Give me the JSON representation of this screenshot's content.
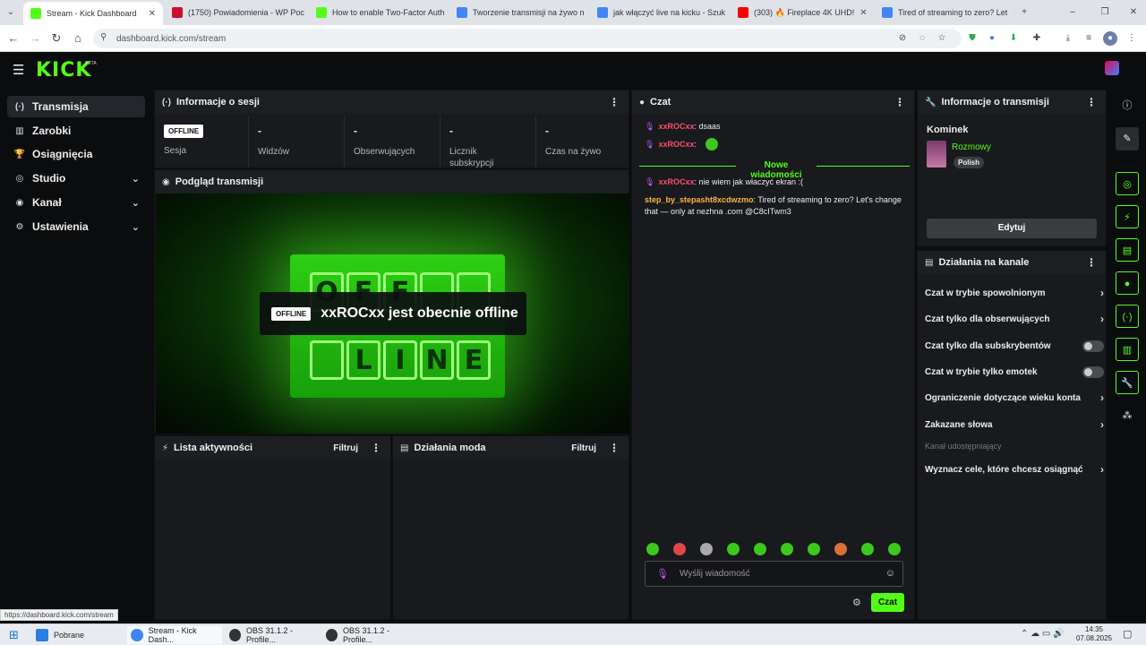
{
  "browser": {
    "tabs": [
      {
        "label": "Stream - Kick Dashboard",
        "color": "#53fc18",
        "active": true
      },
      {
        "label": "(1750) Powiadomienia - WP Poc",
        "color": "#c8102e"
      },
      {
        "label": "How to enable Two-Factor Auth",
        "color": "#53fc18"
      },
      {
        "label": "Tworzenie transmisji na żywo n",
        "color": "#4285f4"
      },
      {
        "label": "jak włączyć live na kicku - Szuk",
        "color": "#4285f4"
      },
      {
        "label": "(303) 🔥 Fireplace 4K UHD!",
        "color": "#ff0000"
      },
      {
        "label": "Tired of streaming to zero? Let",
        "color": "#4285f4"
      }
    ],
    "url": "dashboard.kick.com/stream",
    "status_url": "https://dashboard.kick.com/stream"
  },
  "kick": {
    "logo": "KICK",
    "beta": "BETA"
  },
  "sidebar": {
    "items": [
      {
        "label": "Transmisja",
        "icon": "broadcast-icon",
        "glyph": "(·)"
      },
      {
        "label": "Zarobki",
        "icon": "earnings-icon",
        "glyph": "▥"
      },
      {
        "label": "Osiągnięcia",
        "icon": "trophy-icon",
        "glyph": "🏆"
      },
      {
        "label": "Studio",
        "icon": "studio-icon",
        "glyph": "◎"
      },
      {
        "label": "Kanał",
        "icon": "channel-icon",
        "glyph": "◉"
      },
      {
        "label": "Ustawienia",
        "icon": "settings-icon",
        "glyph": "⚙"
      }
    ]
  },
  "session": {
    "title": "Informacje o sesji",
    "status_badge": "OFFLINE",
    "stats": [
      {
        "value": "",
        "label": "Sesja"
      },
      {
        "value": "-",
        "label": "Widzów"
      },
      {
        "value": "-",
        "label": "Obserwujących"
      },
      {
        "value": "-",
        "label": "Licznik subskrypcji"
      },
      {
        "value": "-",
        "label": "Czas na żywo"
      }
    ]
  },
  "preview": {
    "title": "Podgląd transmisji",
    "badge": "OFFLINE",
    "message": "xxROCxx jest obecnie offline",
    "sign_top": [
      "O",
      "F",
      "F",
      "",
      ""
    ],
    "sign_bottom": [
      "",
      "L",
      "I",
      "N",
      "E"
    ]
  },
  "activity": {
    "title": "Lista aktywności",
    "filter": "Filtruj"
  },
  "mod": {
    "title": "Działania moda",
    "filter": "Filtruj"
  },
  "chat": {
    "title": "Czat",
    "messages_before": [
      {
        "user": "xxROCxx",
        "text": "dsaas"
      },
      {
        "user": "xxROCxx",
        "text": ""
      }
    ],
    "new_messages_label": "Nowe wiadomości",
    "messages_after": [
      {
        "user": "xxROCxx",
        "text": "nie wiem jak właczyć ekran :("
      },
      {
        "user": "step_by_stepasht8xcdwzmo",
        "text": "Tired of streaming to zero? Let's change that — only at nezhna .com @C8cITwm3"
      }
    ],
    "input_placeholder": "Wyślij wiadomość",
    "send_label": "Czat"
  },
  "stream_info": {
    "title": "Informacje o transmisji",
    "stream_title": "Kominek",
    "category": "Rozmowy",
    "language": "Polish",
    "edit_label": "Edytuj"
  },
  "channel_actions": {
    "title": "Działania na kanale",
    "rows": [
      {
        "label": "Czat w trybie spowolnionym",
        "control": "chevron"
      },
      {
        "label": "Czat tylko dla obserwujących",
        "control": "chevron"
      },
      {
        "label": "Czat tylko dla subskrybentów",
        "control": "toggle"
      },
      {
        "label": "Czat w trybie tylko emotek",
        "control": "toggle"
      },
      {
        "label": "Ograniczenie dotyczące wieku konta",
        "control": "chevron"
      },
      {
        "label": "Zakazane słowa",
        "control": "chevron"
      }
    ],
    "shared_label": "Kanał udostępniający",
    "goals_label": "Wyznacz cele, które chcesz osiągnąć"
  },
  "taskbar": {
    "items": [
      {
        "label": "Pobrane",
        "color": "#2a7de1"
      },
      {
        "label": "Stream - Kick Dash...",
        "color": "#4285f4"
      },
      {
        "label": "OBS 31.1.2 - Profile...",
        "color": "#333333"
      },
      {
        "label": "OBS 31.1.2 - Profile...",
        "color": "#333333"
      }
    ],
    "time": "14:35",
    "date": "07.08.2025"
  },
  "colors": {
    "accent": "#53fc18",
    "panel": "#181a1d",
    "bg": "#0b0c0e"
  }
}
